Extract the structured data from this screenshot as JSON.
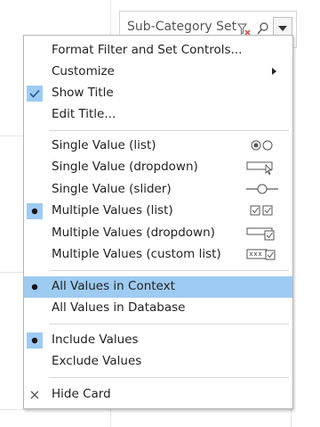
{
  "card": {
    "title": "Sub-Category Set",
    "icons": [
      "clear-filter-icon",
      "search-icon",
      "dropdown-caret-icon"
    ]
  },
  "menu": {
    "items": [
      {
        "label": "Format Filter and Set Controls...",
        "state": "none"
      },
      {
        "label": "Customize",
        "state": "submenu"
      },
      {
        "label": "Show Title",
        "state": "checked"
      },
      {
        "label": "Edit Title...",
        "state": "none"
      },
      {
        "label": "Single Value (list)",
        "state": "none",
        "icon": "radio-buttons-icon"
      },
      {
        "label": "Single Value (dropdown)",
        "state": "none",
        "icon": "dropdown-control-icon"
      },
      {
        "label": "Single Value (slider)",
        "state": "none",
        "icon": "slider-control-icon"
      },
      {
        "label": "Multiple Values (list)",
        "state": "bullet",
        "icon": "checkbox-list-icon"
      },
      {
        "label": "Multiple Values (dropdown)",
        "state": "none",
        "icon": "multi-dropdown-icon"
      },
      {
        "label": "Multiple Values (custom list)",
        "state": "none",
        "icon": "custom-list-icon"
      },
      {
        "label": "All Values in Context",
        "state": "bullet",
        "highlighted": true
      },
      {
        "label": "All Values in Database",
        "state": "none"
      },
      {
        "label": "Include Values",
        "state": "bullet"
      },
      {
        "label": "Exclude Values",
        "state": "none"
      },
      {
        "label": "Hide Card",
        "state": "x"
      }
    ]
  },
  "colors": {
    "highlight": "#9ecbf1",
    "mark_bg": "#9ecbf1",
    "menu_border": "#b7b7b7"
  }
}
